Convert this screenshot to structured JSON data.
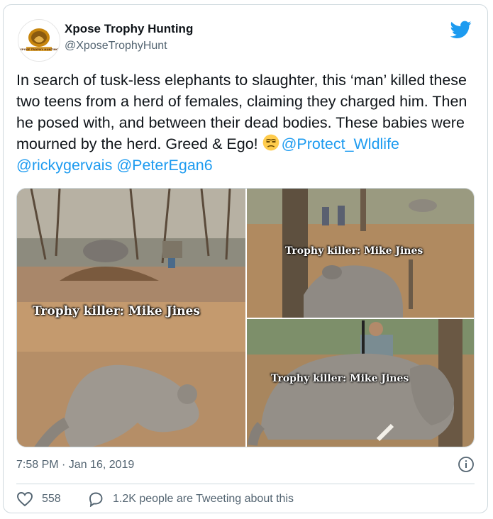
{
  "account": {
    "display_name": "Xpose Trophy Hunting",
    "handle": "@XposeTrophyHunt",
    "avatar_text": "XPOSE TROPHY HUNTING"
  },
  "tweet": {
    "text": "In search of tusk-less elephants to slaughter, this ‘man’ killed these two teens from a herd of females, claiming they charged him. Then he posed with, and between their dead bodies. These babies were mourned by the herd. Greed & Ego!",
    "emoji": "unamused-face-emoji",
    "mentions": [
      "@Protect_Wldlife",
      "@rickygervais",
      "@PeterEgan6"
    ]
  },
  "media": {
    "captions": [
      "Trophy killer: Mike Jines",
      "Trophy killer: Mike Jines",
      "Trophy killer: Mike Jines"
    ]
  },
  "timestamp": "7:58 PM · Jan 16, 2019",
  "engagement": {
    "likes": "558",
    "conversation": "1.2K people are Tweeting about this"
  },
  "icons": {
    "brand": "twitter-bird-icon",
    "info": "info-icon",
    "like": "heart-icon",
    "reply": "speech-bubble-icon"
  },
  "colors": {
    "link": "#1d9bf0",
    "brand": "#1d9bf0",
    "text": "#0f1419",
    "secondary": "#536471",
    "border": "#cfd9de"
  }
}
